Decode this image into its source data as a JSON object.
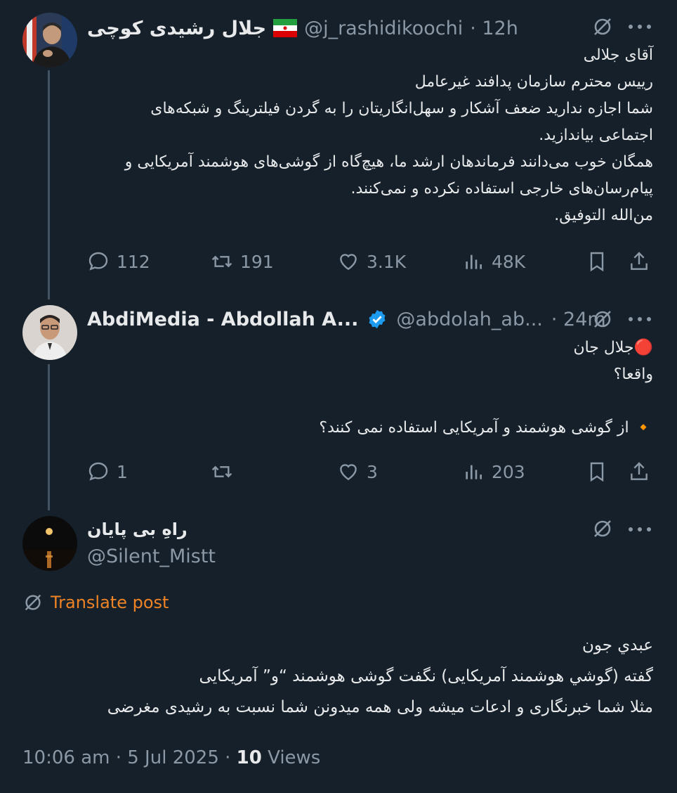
{
  "posts": [
    {
      "display_name": "جلال رشیدی کوچی",
      "flag": "🇮🇷",
      "handle": "@j_rashidikoochi",
      "time": "· 12h",
      "lines": [
        "آقای جلالی",
        "رییس محترم سازمان پدافند غیرعامل",
        "شما اجازه ندارید ضعف آشکار و سهل‌انگاریتان را به گردن فیلترینگ و شبکه‌های",
        "اجتماعی بیاندازید.",
        "همگان خوب می‌دانند فرماندهان ارشد ما، هیچ‌گاه از گوشی‌های هوشمند آمریکایی و",
        "پیام‌رسان‌های خارجی استفاده نکرده و نمی‌کنند.",
        "من‌الله التوفیق."
      ],
      "stats": {
        "replies": "112",
        "reposts": "191",
        "likes": "3.1K",
        "views": "48K"
      }
    },
    {
      "display_name": "AbdiMedia - Abdollah A...",
      "verified": true,
      "handle": "@abdolah_ab...",
      "time": "· 24m",
      "lines": [
        "🔴جلال جان",
        "واقعا؟",
        "",
        "🔸 از گوشی هوشمند و آمریکایی استفاده نمی کنند؟"
      ],
      "stats": {
        "replies": "1",
        "reposts": "",
        "likes": "3",
        "views": "203"
      }
    },
    {
      "display_name": "راهِ بی پایان",
      "handle": "@Silent_Mistt",
      "translate_label": "Translate post",
      "lines": [
        "عبدي جون",
        "گفته (گوشي هوشمند آمريكايى) نگفت گوشى هوشمند “و” آمريكايى",
        "مثلا شما خبرنگارى و ادعات ميشه ولى همه ميدونن شما نسبت به رشيدى مغرضى"
      ]
    }
  ],
  "footer": {
    "datetime": "10:06 am · 5 Jul 2025 · ",
    "views_count": "10",
    "views_label": " Views"
  },
  "colors": {
    "background": "#15202b",
    "text": "#e7e9ea",
    "muted": "#8b98a5",
    "accent": "#ee8325",
    "verified": "#1d9bf0",
    "thread_line": "#425364"
  }
}
